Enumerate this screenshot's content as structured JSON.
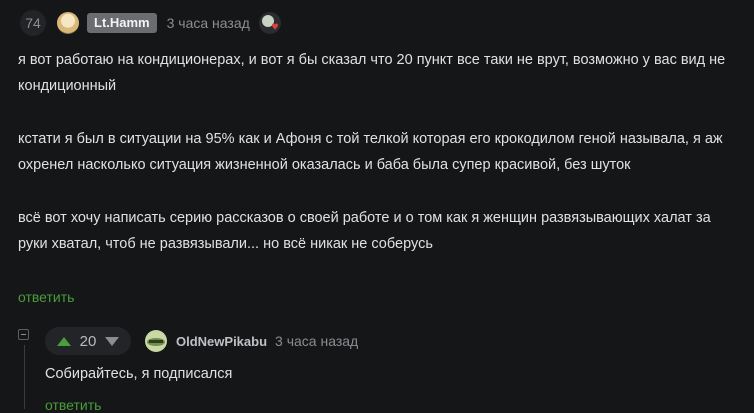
{
  "comment": {
    "rating": "74",
    "username": "Lt.Hamm",
    "time": "3 часа назад",
    "paragraphs": [
      "я вот работаю на кондиционерах, и вот я бы сказал что 20 пункт все таки не врут, возможно у вас вид не кондиционный",
      "кстати я был в ситуации на 95% как и Афоня с той телкой которая его крокодилом геной называла, я аж охренел насколько ситуация жизненной оказалась и баба была супер красивой, без шуток",
      "всё вот хочу написать серию рассказов о своей работе и о том как я женщин развязывающих халат за руки хватал, чтоб не развязывали... но всё никак не соберусь"
    ],
    "reply_label": "ответить"
  },
  "reply": {
    "votes": "20",
    "username": "OldNewPikabu",
    "time": "3 часа назад",
    "text": "Собирайтесь, я подписался",
    "reply_label": "ответить"
  },
  "icons": {
    "avatar": "avatar-icon",
    "award": "award-heart-icon",
    "collapse": "collapse-minus-icon",
    "upvote": "upvote-arrow-icon",
    "downvote": "downvote-arrow-icon"
  },
  "colors": {
    "background": "#151618",
    "text": "#e1e1e1",
    "muted": "#8b8d91",
    "accent_green": "#4a9d3a",
    "badge_bg": "#6a6c70"
  }
}
